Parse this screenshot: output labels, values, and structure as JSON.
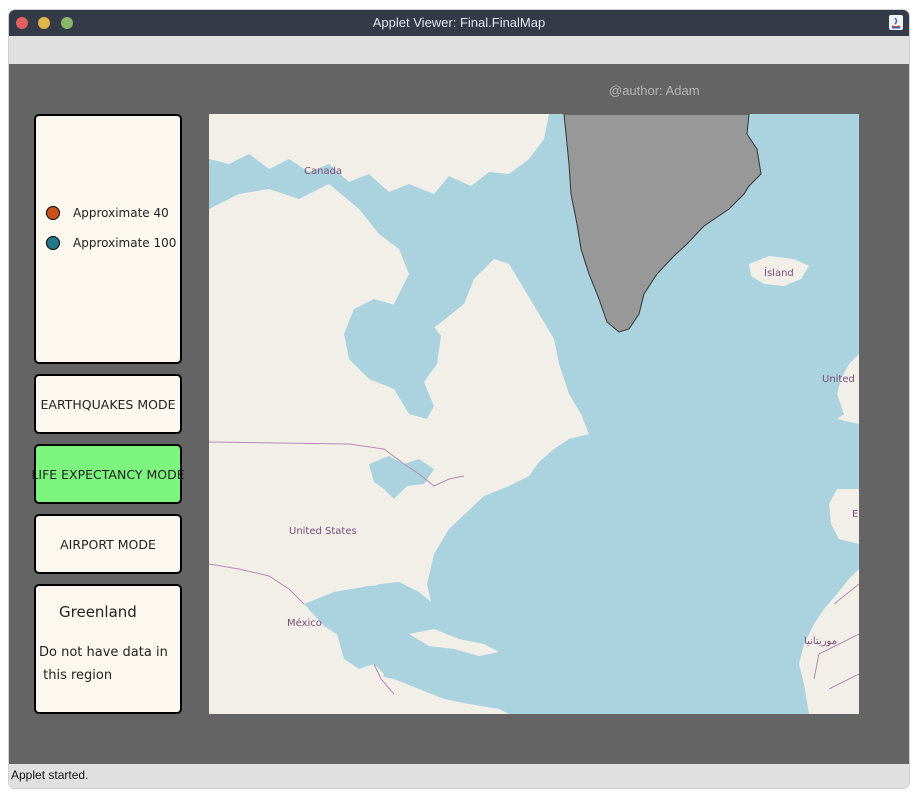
{
  "window": {
    "title": "Applet Viewer: Final.FinalMap"
  },
  "author": "@author: Adam",
  "legend": {
    "items": [
      {
        "label": "Approximate 40",
        "color": "#c8501c"
      },
      {
        "label": "Approximate 100",
        "color": "#207888"
      }
    ]
  },
  "modes": [
    {
      "label": "EARTHQUAKES MODE",
      "active": false
    },
    {
      "label": "LIFE EXPECTANCY MODE",
      "active": true
    },
    {
      "label": "AIRPORT MODE",
      "active": false
    }
  ],
  "active_color": "#7cf47e",
  "info": {
    "title": "Greenland",
    "line1": "Do not have data in",
    "line2": " this region"
  },
  "map": {
    "labels": {
      "canada": "Canada",
      "united_states": "United States",
      "mexico": "México",
      "iceland": "Ísland",
      "united_kingdom": "United",
      "east_edge": "E",
      "mauritania": "موريتانيا"
    },
    "colors": {
      "water": "#abd3df",
      "land": "#f2efe9",
      "selected": "#989898",
      "border": "#b48ab4"
    }
  },
  "status": "Applet started."
}
